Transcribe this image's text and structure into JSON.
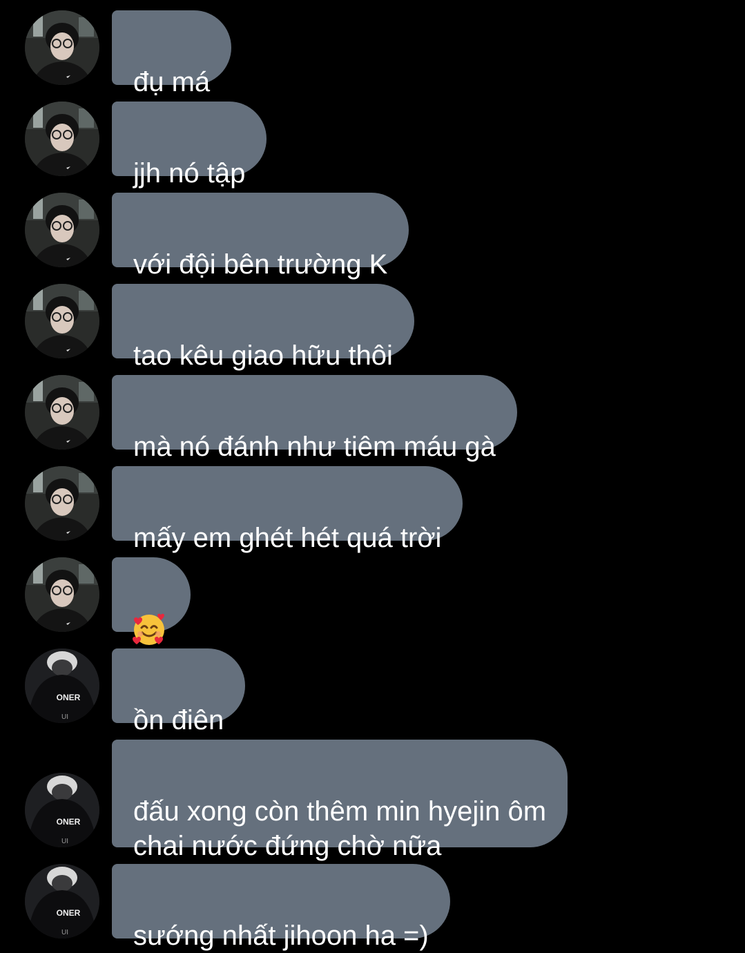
{
  "colors": {
    "background": "#000000",
    "bubble": "#65707d",
    "text": "#ffffff"
  },
  "messages": [
    {
      "avatar": "avatar-glasses-icon",
      "text": "đụ má"
    },
    {
      "avatar": "avatar-glasses-icon",
      "text": "jjh nó tập"
    },
    {
      "avatar": "avatar-glasses-icon",
      "text": "với đội bên trường K"
    },
    {
      "avatar": "avatar-glasses-icon",
      "text": "tao kêu giao hữu thôi"
    },
    {
      "avatar": "avatar-glasses-icon",
      "text": "mà nó đánh như tiêm máu gà"
    },
    {
      "avatar": "avatar-glasses-icon",
      "text": "mấy em ghét hét quá trời"
    },
    {
      "avatar": "avatar-glasses-icon",
      "emoji": "smiling-face-with-hearts-emoji"
    },
    {
      "avatar": "avatar-oner-icon",
      "text": "ồn điên",
      "jersey": "ONER"
    },
    {
      "avatar": "avatar-oner-icon",
      "text": "đấu xong còn thêm min hyejin ôm\nchai nước đứng chờ nữa",
      "jersey": "ONER"
    },
    {
      "avatar": "avatar-oner-icon",
      "text": "sướng nhất jihoon ha =)",
      "jersey": "ONER"
    }
  ]
}
